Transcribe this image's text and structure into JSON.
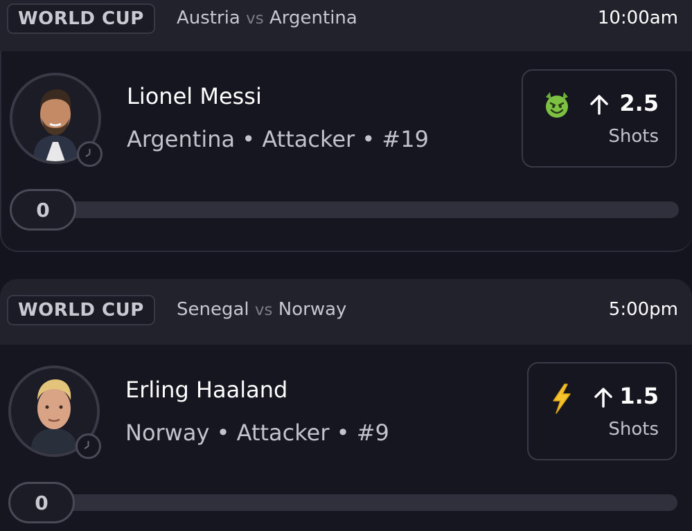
{
  "cards": [
    {
      "league": "WORLD CUP",
      "home_team": "Austria",
      "vs": "vs",
      "away_team": "Argentina",
      "time": "10:00am",
      "player_name": "Lionel Messi",
      "player_meta": "Argentina • Attacker • #19",
      "pick_icon": "devil-emoji-icon",
      "direction": "up-arrow-icon",
      "line": "2.5",
      "stat": "Shots",
      "progress_value": "0",
      "progress_fraction": 0
    },
    {
      "league": "WORLD CUP",
      "home_team": "Senegal",
      "vs": "vs",
      "away_team": "Norway",
      "time": "5:00pm",
      "player_name": "Erling Haaland",
      "player_meta": "Norway • Attacker • #9",
      "pick_icon": "lightning-bolt-icon",
      "direction": "up-arrow-icon",
      "line": "1.5",
      "stat": "Shots",
      "progress_value": "0",
      "progress_fraction": 0
    }
  ],
  "colors": {
    "background": "#14141f",
    "header": "#22222d",
    "card": "#161620",
    "track": "#30303c",
    "text_primary": "#ffffff",
    "text_secondary": "#c3c3cc",
    "devil": "#7dc142",
    "bolt": "#f5c42c"
  }
}
